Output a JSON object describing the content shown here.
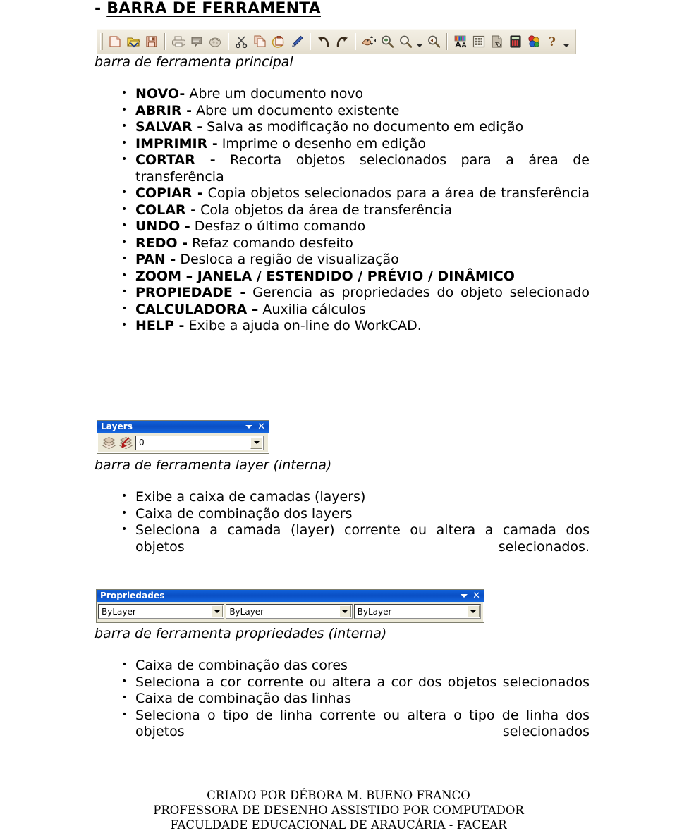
{
  "heading": {
    "prefix": "- ",
    "underlined": "BARRA DE FERRAMENTA"
  },
  "main_toolbar": {
    "caption": "barra de ferramenta principal",
    "buttons": [
      {
        "name": "new-document-icon",
        "tooltip": "NOVO"
      },
      {
        "name": "open-document-icon",
        "tooltip": "ABRIR"
      },
      {
        "name": "save-icon",
        "tooltip": "SALVAR"
      },
      {
        "name": "print-icon",
        "tooltip": "IMPRIMIR"
      },
      {
        "name": "print-preview-icon",
        "tooltip": "VISUALIZAR"
      },
      {
        "name": "plot-icon",
        "tooltip": "PLOTAR"
      },
      {
        "name": "cut-scissors-icon",
        "tooltip": "CORTAR"
      },
      {
        "name": "copy-icon",
        "tooltip": "COPIAR"
      },
      {
        "name": "paste-icon",
        "tooltip": "COLAR"
      },
      {
        "name": "match-properties-pencil-icon",
        "tooltip": "PINCEL"
      },
      {
        "name": "undo-arrow-icon",
        "tooltip": "UNDO"
      },
      {
        "name": "redo-arrow-icon",
        "tooltip": "REDO"
      },
      {
        "name": "pan-hand-icon",
        "tooltip": "PAN"
      },
      {
        "name": "zoom-in-icon",
        "tooltip": "ZOOM"
      },
      {
        "name": "zoom-window-icon",
        "tooltip": "ZOOM JANELA"
      },
      {
        "name": "zoom-previous-icon",
        "tooltip": "ZOOM PREVIO"
      },
      {
        "name": "text-style-icon",
        "tooltip": "ESTILO DE TEXTO"
      },
      {
        "name": "grid-table-icon",
        "tooltip": "GRADE"
      },
      {
        "name": "properties-icon",
        "tooltip": "PROPIEDADE"
      },
      {
        "name": "calculator-icon",
        "tooltip": "CALCULADORA"
      },
      {
        "name": "colors-icon",
        "tooltip": "CORES"
      },
      {
        "name": "help-question-icon",
        "tooltip": "HELP"
      }
    ],
    "overflow_label": "▾"
  },
  "main_list": [
    {
      "term": "NOVO-",
      "desc": " Abre um documento novo"
    },
    {
      "term": "ABRIR -",
      "desc": " Abre um documento existente"
    },
    {
      "term": "SALVAR -",
      "desc": " Salva as modificação no documento em edição"
    },
    {
      "term": "IMPRIMIR -",
      "desc": " Imprime o desenho em edição"
    },
    {
      "term": "CORTAR -",
      "desc": " Recorta objetos selecionados para a área de transferência"
    },
    {
      "term": "COPIAR -",
      "desc": " Copia objetos selecionados para a área de transferência"
    },
    {
      "term": "COLAR -",
      "desc": " Cola objetos da área de transferência"
    },
    {
      "term": "UNDO -",
      "desc": " Desfaz o último comando"
    },
    {
      "term": "REDO -",
      "desc": " Refaz comando desfeito"
    },
    {
      "term": "PAN -",
      "desc": " Desloca a região de visualização"
    },
    {
      "term": "ZOOM – JANELA / ESTENDIDO / PRÉVIO / DINÂMICO",
      "desc": ""
    },
    {
      "term": "PROPIEDADE -",
      "desc": " Gerencia as propriedades do objeto selecionado"
    },
    {
      "term": "CALCULADORA –",
      "desc": " Auxilia cálculos"
    },
    {
      "term": "HELP -",
      "desc": " Exibe a ajuda on-line do WorkCAD."
    }
  ],
  "layers_panel": {
    "title": "Layers",
    "caret_icon": "chevron-down-icon",
    "close_icon": "close-icon",
    "icons": [
      {
        "name": "layers-stack-icon"
      },
      {
        "name": "layers-current-icon"
      }
    ],
    "combo_value": "0",
    "caption": "barra de ferramenta layer (interna)"
  },
  "layers_list": [
    "Exibe a caixa de camadas (layers)",
    "Caixa de combinação dos layers",
    "Seleciona a camada (layer) corrente ou altera a camada dos objetos selecionados."
  ],
  "properties_panel": {
    "title": "Propriedades",
    "caret_icon": "chevron-down-icon",
    "close_icon": "close-icon",
    "combos": [
      "ByLayer",
      "ByLayer",
      "ByLayer"
    ],
    "caption": "barra de ferramenta propriedades (interna)"
  },
  "properties_list": [
    "Caixa de combinação das cores",
    "Seleciona a cor corrente ou altera a cor dos objetos selecionados",
    "Caixa de combinação das linhas",
    "Seleciona o tipo de linha corrente ou altera o tipo de linha dos objetos selecionados"
  ],
  "footer": {
    "line1": "CRIADO POR DÉBORA M. BUENO FRANCO",
    "line2": "PROFESSORA DE DESENHO ASSISTIDO POR COMPUTADOR",
    "line3": "FACULDADE EDUCACIONAL DE ARAUCÁRIA - FACEAR"
  },
  "colors": {
    "titlebar_blue": "#0a4fc4",
    "panel_face": "#ece9d8",
    "toolbar_face": "#ece7da"
  }
}
